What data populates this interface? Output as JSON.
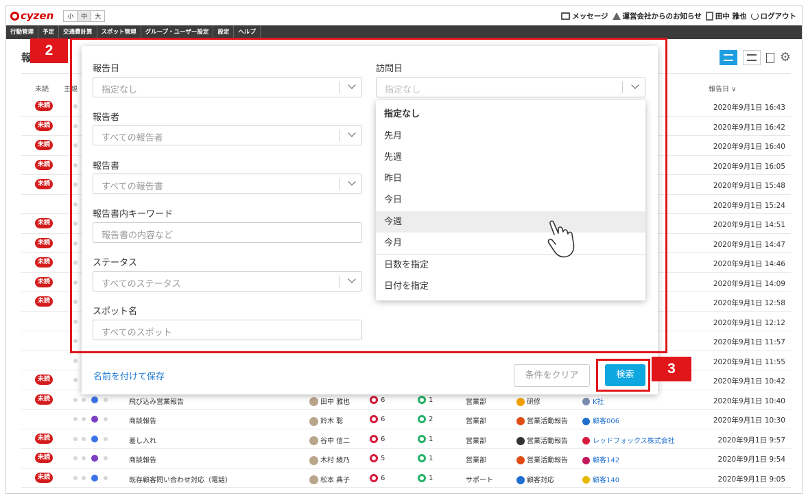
{
  "header": {
    "logo": "cyzen",
    "font_sizes": [
      "小",
      "中",
      "大"
    ],
    "messages": "メッセージ",
    "notice": "運営会社からのお知らせ",
    "user": "田中 雅也",
    "logout": "ログアウト"
  },
  "nav": [
    "行動管理",
    "予定",
    "交通費計算",
    "スポット管理",
    "グループ・ユーザー設定",
    "設定",
    "ヘルプ"
  ],
  "page": {
    "title": "報"
  },
  "table": {
    "headers": {
      "unread": "未読",
      "col2": "主観",
      "date": "報告日 ∨"
    },
    "rows": [
      {
        "unread": "未読",
        "title": "",
        "reporter": "",
        "likes": "",
        "comments": "",
        "dept": "",
        "category": "",
        "customer": "",
        "date": "2020年9月1日 16:43"
      },
      {
        "unread": "未読",
        "title": "",
        "reporter": "",
        "likes": "",
        "comments": "",
        "dept": "",
        "category": "",
        "customer": "",
        "date": "2020年9月1日 16:42"
      },
      {
        "unread": "未読",
        "title": "",
        "reporter": "",
        "likes": "",
        "comments": "",
        "dept": "",
        "category": "",
        "customer": "",
        "date": "2020年9月1日 16:40"
      },
      {
        "unread": "未読",
        "title": "",
        "reporter": "",
        "likes": "",
        "comments": "",
        "dept": "",
        "category": "",
        "customer": "",
        "date": "2020年9月1日 16:05"
      },
      {
        "unread": "未読",
        "title": "",
        "reporter": "",
        "likes": "",
        "comments": "",
        "dept": "",
        "category": "",
        "customer": "",
        "date": "2020年9月1日 15:48"
      },
      {
        "unread": "",
        "title": "",
        "reporter": "",
        "likes": "",
        "comments": "",
        "dept": "",
        "category": "",
        "customer": "",
        "date": "2020年9月1日 15:24"
      },
      {
        "unread": "未読",
        "title": "",
        "reporter": "",
        "likes": "",
        "comments": "",
        "dept": "",
        "category": "",
        "customer": "",
        "date": "2020年9月1日 14:51"
      },
      {
        "unread": "未読",
        "title": "",
        "reporter": "",
        "likes": "",
        "comments": "",
        "dept": "",
        "category": "",
        "customer": "",
        "date": "2020年9月1日 14:47"
      },
      {
        "unread": "未読",
        "title": "",
        "reporter": "",
        "likes": "",
        "comments": "",
        "dept": "",
        "category": "",
        "customer": "",
        "date": "2020年9月1日 14:46"
      },
      {
        "unread": "未読",
        "title": "",
        "reporter": "",
        "likes": "",
        "comments": "",
        "dept": "",
        "category": "",
        "customer": "",
        "date": "2020年9月1日 14:09"
      },
      {
        "unread": "未読",
        "title": "",
        "reporter": "",
        "likes": "",
        "comments": "",
        "dept": "",
        "category": "",
        "customer": "",
        "date": "2020年9月1日 12:58"
      },
      {
        "unread": "",
        "title": "",
        "reporter": "",
        "likes": "",
        "comments": "",
        "dept": "",
        "category": "",
        "customer": "",
        "date": "2020年9月1日 12:12"
      },
      {
        "unread": "",
        "title": "",
        "reporter": "",
        "likes": "",
        "comments": "",
        "dept": "",
        "category": "",
        "customer": "",
        "date": "2020年9月1日 11:57"
      },
      {
        "unread": "",
        "title": "",
        "reporter": "",
        "likes": "",
        "comments": "",
        "dept": "",
        "category": "",
        "customer": "",
        "date": "2020年9月1日 11:55"
      },
      {
        "unread": "未読",
        "title": "",
        "reporter": "",
        "likes": "",
        "comments": "",
        "dept": "",
        "category": "",
        "customer": "",
        "date": "2020年9月1日 10:42"
      },
      {
        "unread": "未読",
        "title": "飛び込み営業報告",
        "reporter": "田中 雅也",
        "likes": "6",
        "comments": "1",
        "dept": "営業部",
        "category": "研修",
        "customer": "K社",
        "date": "2020年9月1日 10:40"
      },
      {
        "unread": "",
        "title": "商談報告",
        "reporter": "鈴木 聡",
        "likes": "6",
        "comments": "2",
        "dept": "営業部",
        "category": "営業活動報告",
        "customer": "顧客006",
        "date": "2020年9月1日 10:30"
      },
      {
        "unread": "未読",
        "title": "差し入れ",
        "reporter": "谷中 信二",
        "likes": "6",
        "comments": "1",
        "dept": "営業部",
        "category": "営業活動報告",
        "customer": "レッドフォックス株式会社",
        "date": "2020年9月1日 9:57"
      },
      {
        "unread": "未読",
        "title": "商談報告",
        "reporter": "木村 綾乃",
        "likes": "5",
        "comments": "1",
        "dept": "営業部",
        "category": "営業活動報告",
        "customer": "顧客142",
        "date": "2020年9月1日 9:54"
      },
      {
        "unread": "未読",
        "title": "既存顧客問い合わせ対応（電話）",
        "reporter": "松本 典子",
        "likes": "6",
        "comments": "1",
        "dept": "サポート",
        "category": "顧客対応",
        "customer": "顧客140",
        "date": "2020年9月1日 9:05"
      }
    ]
  },
  "filter": {
    "report_date": {
      "label": "報告日",
      "placeholder": "指定なし"
    },
    "visit_date": {
      "label": "訪問日",
      "placeholder": "指定なし"
    },
    "reporter": {
      "label": "報告者",
      "placeholder": "すべての報告者"
    },
    "report_form": {
      "label": "報告書",
      "placeholder": "すべての報告書"
    },
    "keyword": {
      "label": "報告書内キーワード",
      "placeholder": "報告書の内容など"
    },
    "status": {
      "label": "ステータス",
      "placeholder": "すべてのステータス"
    },
    "spot": {
      "label": "スポット名",
      "placeholder": "すべてのスポット"
    },
    "dropdown_options": [
      "指定なし",
      "先月",
      "先週",
      "昨日",
      "今日",
      "今週",
      "今月",
      "日数を指定",
      "日付を指定"
    ],
    "save_link": "名前を付けて保存",
    "clear_button": "条件をクリア",
    "search_button": "検索"
  },
  "annotations": {
    "marker2": "2",
    "marker3": "3"
  },
  "colors": {
    "accent": "#0ea7df",
    "annotation_red": "#e0161b",
    "unread_badge": "#d41c1c",
    "nav_bg": "#3b3b3b"
  }
}
